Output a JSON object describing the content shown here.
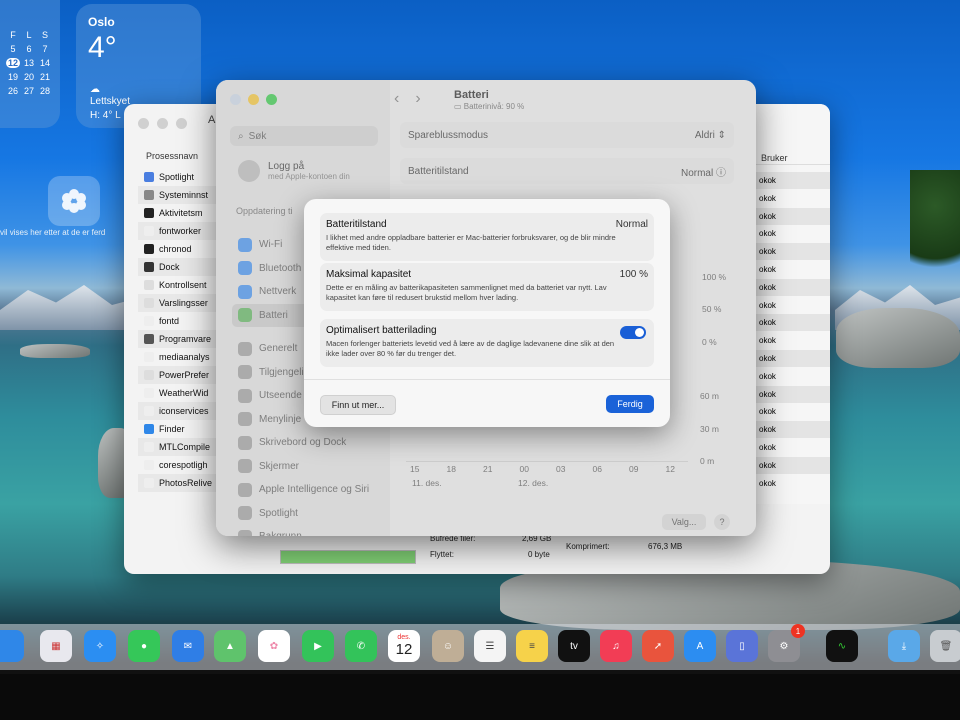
{
  "desktop": {
    "calendar": {
      "days": [
        "F",
        "L",
        "S",
        "5",
        "6",
        "7",
        "12",
        "13",
        "14",
        "19",
        "20",
        "21",
        "26",
        "27",
        "28"
      ],
      "selected": "12"
    },
    "weather": {
      "city": "Oslo",
      "temp": "4°",
      "condition": "Lettskyet",
      "hilo": "H: 4° L"
    },
    "photos_caption": "vil vises her etter at de er ferd"
  },
  "activity_monitor": {
    "title_letter": "A",
    "col_process": "Prosessnavn",
    "col_user": "Bruker",
    "processes": [
      "Spotlight",
      "Systeminnst",
      "Aktivitetsm",
      "fontworker",
      "chronod",
      "Dock",
      "Kontrollsent",
      "Varslingsser",
      "fontd",
      "Programvare",
      "mediaanalys",
      "PowerPrefer",
      "WeatherWid",
      "iconservices",
      "Finder",
      "MTLCompile",
      "corespotligh",
      "PhotosRelive"
    ],
    "user_values": [
      "okok",
      "okok",
      "okok",
      "okok",
      "okok",
      "okok",
      "okok",
      "okok",
      "okok",
      "okok",
      "okok",
      "okok",
      "okok",
      "okok",
      "okok",
      "okok",
      "okok",
      "okok"
    ],
    "bottom": {
      "buffer_label": "Bufrede filer:",
      "buffer_value": "2,69 GB",
      "moved_label": "Flyttet:",
      "moved_value": "0 byte",
      "compressed_label": "Komprimert:",
      "compressed_value": "676,3 MB"
    }
  },
  "settings": {
    "search_placeholder": "Søk",
    "login_title": "Logg på",
    "login_sub": "med Apple-kontoen din",
    "update_text": "Oppdatering ti",
    "nav": [
      "Wi-Fi",
      "Bluetooth",
      "Nettverk",
      "Batteri",
      "Generelt",
      "Tilgjengelig",
      "Utseende",
      "Menylinje",
      "Skrivebord og Dock",
      "Skjermer",
      "Apple Intelligence og Siri",
      "Spotlight",
      "Bakgrunn"
    ],
    "selected_nav": "Batteri",
    "title": "Batteri",
    "subtitle": "Batterinivå: 90 %",
    "rows": [
      {
        "label": "Spareblussmodus",
        "value": "Aldri"
      },
      {
        "label": "Batteritilstand",
        "value": "Normal"
      }
    ],
    "chart_y": [
      "100 %",
      "50 %",
      "0 %",
      "60 m",
      "30 m",
      "0 m"
    ],
    "chart_x": [
      "15",
      "18",
      "21",
      "00",
      "03",
      "06",
      "09",
      "12"
    ],
    "chart_dates": [
      "11. des.",
      "12. des."
    ],
    "valg": "Valg...",
    "help": "?"
  },
  "modal": {
    "sections": [
      {
        "title": "Batteritilstand",
        "value": "Normal",
        "desc": "I likhet med andre oppladbare batterier er Mac-batterier forbruksvarer, og de blir mindre effektive med tiden."
      },
      {
        "title": "Maksimal kapasitet",
        "value": "100 %",
        "desc": "Dette er en måling av batterikapasiteten sammenlignet med da batteriet var nytt. Lav kapasitet kan føre til redusert brukstid mellom hver lading."
      },
      {
        "title": "Optimalisert batterilading",
        "value": "",
        "desc": "Macen forlenger batteriets levetid ved å lære av de daglige ladevanene dine slik at den ikke lader over 80 % før du trenger det."
      }
    ],
    "optimized_on": true,
    "learn_more": "Finn ut mer...",
    "done": "Ferdig"
  },
  "dock": {
    "calendar_month": "des.",
    "calendar_day": "12",
    "settings_badge": "1",
    "tv_label": "tv"
  }
}
